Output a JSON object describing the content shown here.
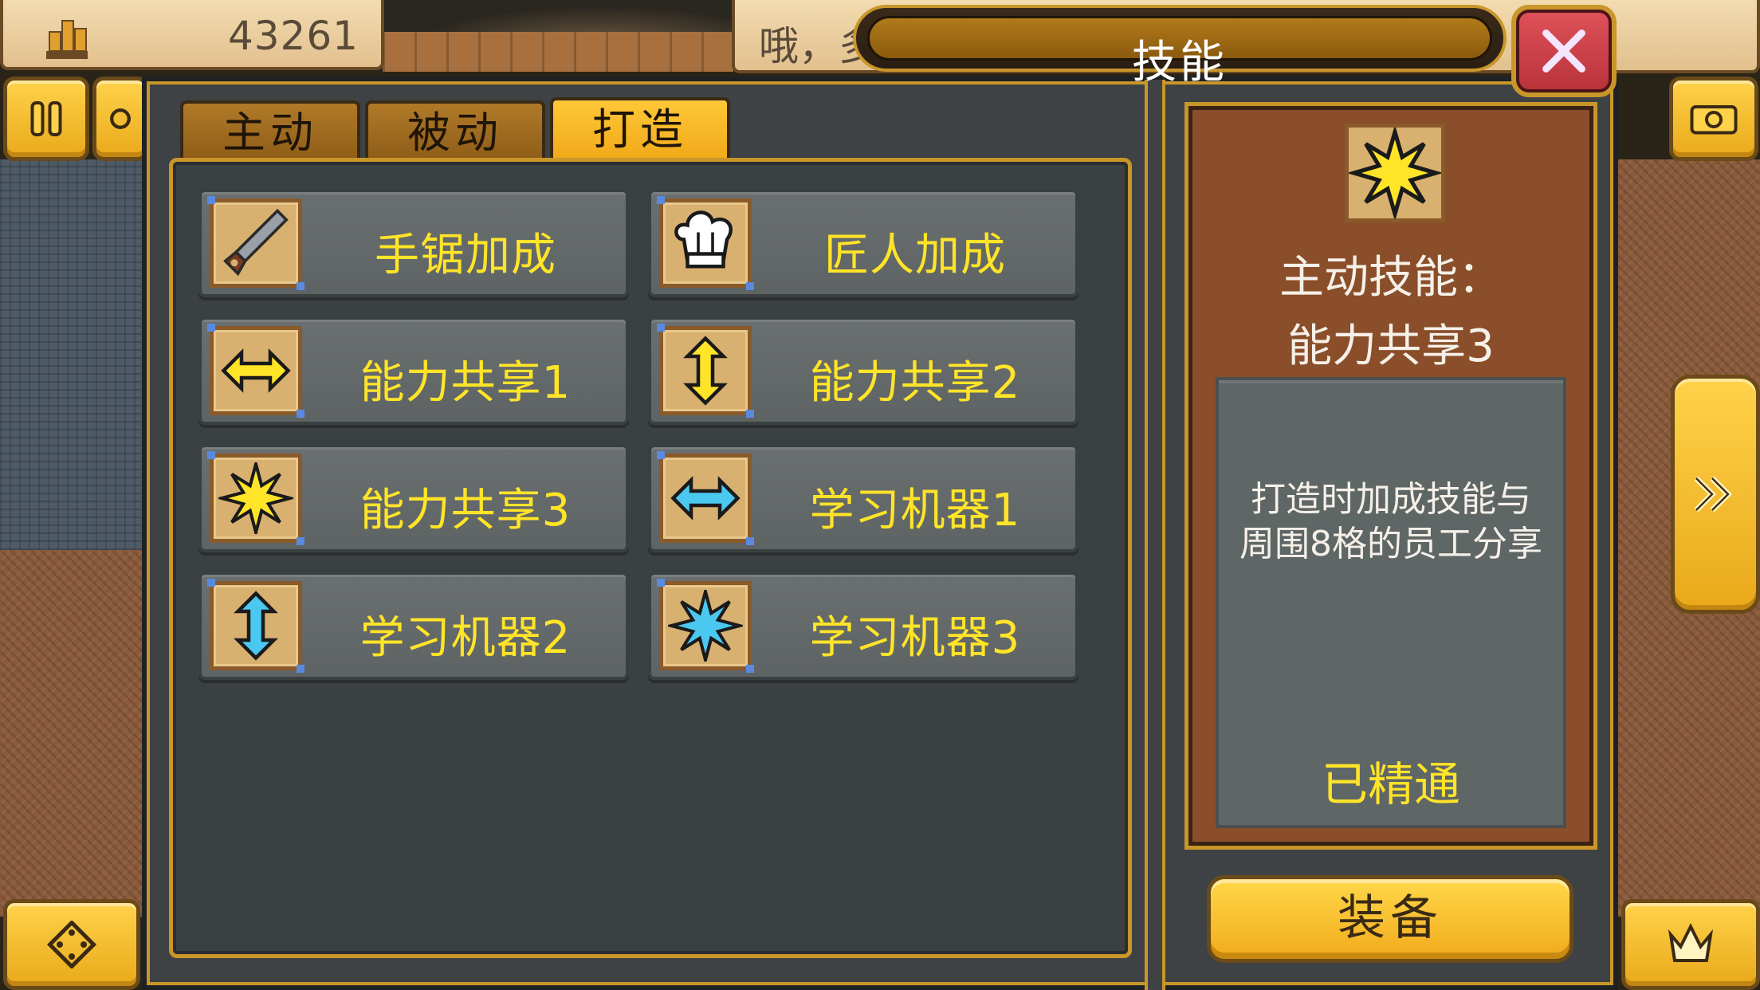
{
  "hud": {
    "money_value": "43261",
    "dialog_text": "哦，多"
  },
  "window": {
    "title": "技能"
  },
  "tabs": [
    {
      "label": "主动",
      "active": false
    },
    {
      "label": "被动",
      "active": false
    },
    {
      "label": "打造",
      "active": true
    }
  ],
  "skills": [
    {
      "label": "手锯加成",
      "icon": "saw-icon"
    },
    {
      "label": "匠人加成",
      "icon": "chef-hat-icon"
    },
    {
      "label": "能力共享1",
      "icon": "arrow-horizontal-yellow-icon"
    },
    {
      "label": "能力共享2",
      "icon": "arrow-vertical-yellow-icon"
    },
    {
      "label": "能力共享3",
      "icon": "star-burst-yellow-icon"
    },
    {
      "label": "学习机器1",
      "icon": "arrow-horizontal-blue-icon"
    },
    {
      "label": "学习机器2",
      "icon": "arrow-vertical-blue-icon"
    },
    {
      "label": "学习机器3",
      "icon": "star-burst-blue-icon"
    }
  ],
  "detail": {
    "icon": "star-burst-yellow-icon",
    "type_label": "主动技能：",
    "name": "能力共享3",
    "description_line1": "打造时加成技能与",
    "description_line2": "周围8格的员工分享",
    "status": "已精通",
    "equip_label": "装备"
  },
  "colors": {
    "accent_gold": "#c9962a",
    "skill_text": "#ffe428",
    "close_red": "#c9424a",
    "panel_brown": "#8a4e2a",
    "panel_gray": "#3b4143"
  }
}
